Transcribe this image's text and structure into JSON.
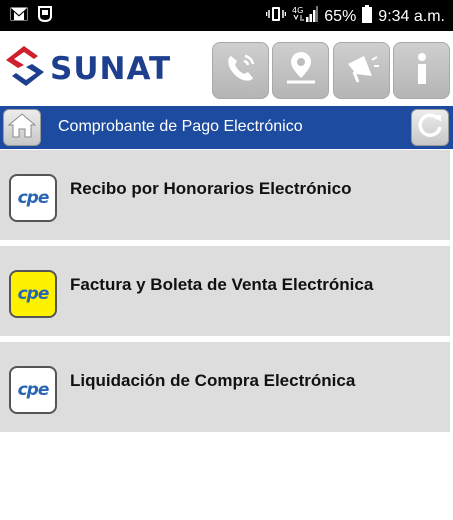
{
  "status_bar": {
    "battery": "65%",
    "time": "9:34 a.m.",
    "network": "4G",
    "icons": [
      "gmail-icon",
      "notification-icon",
      "vibrate-icon",
      "signal-icon",
      "battery-icon"
    ]
  },
  "header": {
    "logo_text": "SUNAT",
    "buttons": [
      "phone-icon",
      "location-icon",
      "megaphone-icon",
      "info-icon"
    ]
  },
  "title_bar": {
    "title": "Comprobante de Pago Electrónico",
    "home_icon": "home-icon",
    "refresh_icon": "refresh-icon"
  },
  "menu": {
    "items": [
      {
        "label": "Recibo por Honorarios Electrónico",
        "icon_text": "cpe",
        "highlight": false
      },
      {
        "label": "Factura y Boleta de Venta Electrónica",
        "icon_text": "cpe",
        "highlight": true
      },
      {
        "label": "Liquidación de Compra Electrónica",
        "icon_text": "cpe",
        "highlight": false
      }
    ]
  },
  "colors": {
    "brand_blue": "#1d4b9f",
    "logo_red": "#d0202e",
    "item_bg": "#dddddd",
    "highlight_yellow": "#fff200"
  }
}
